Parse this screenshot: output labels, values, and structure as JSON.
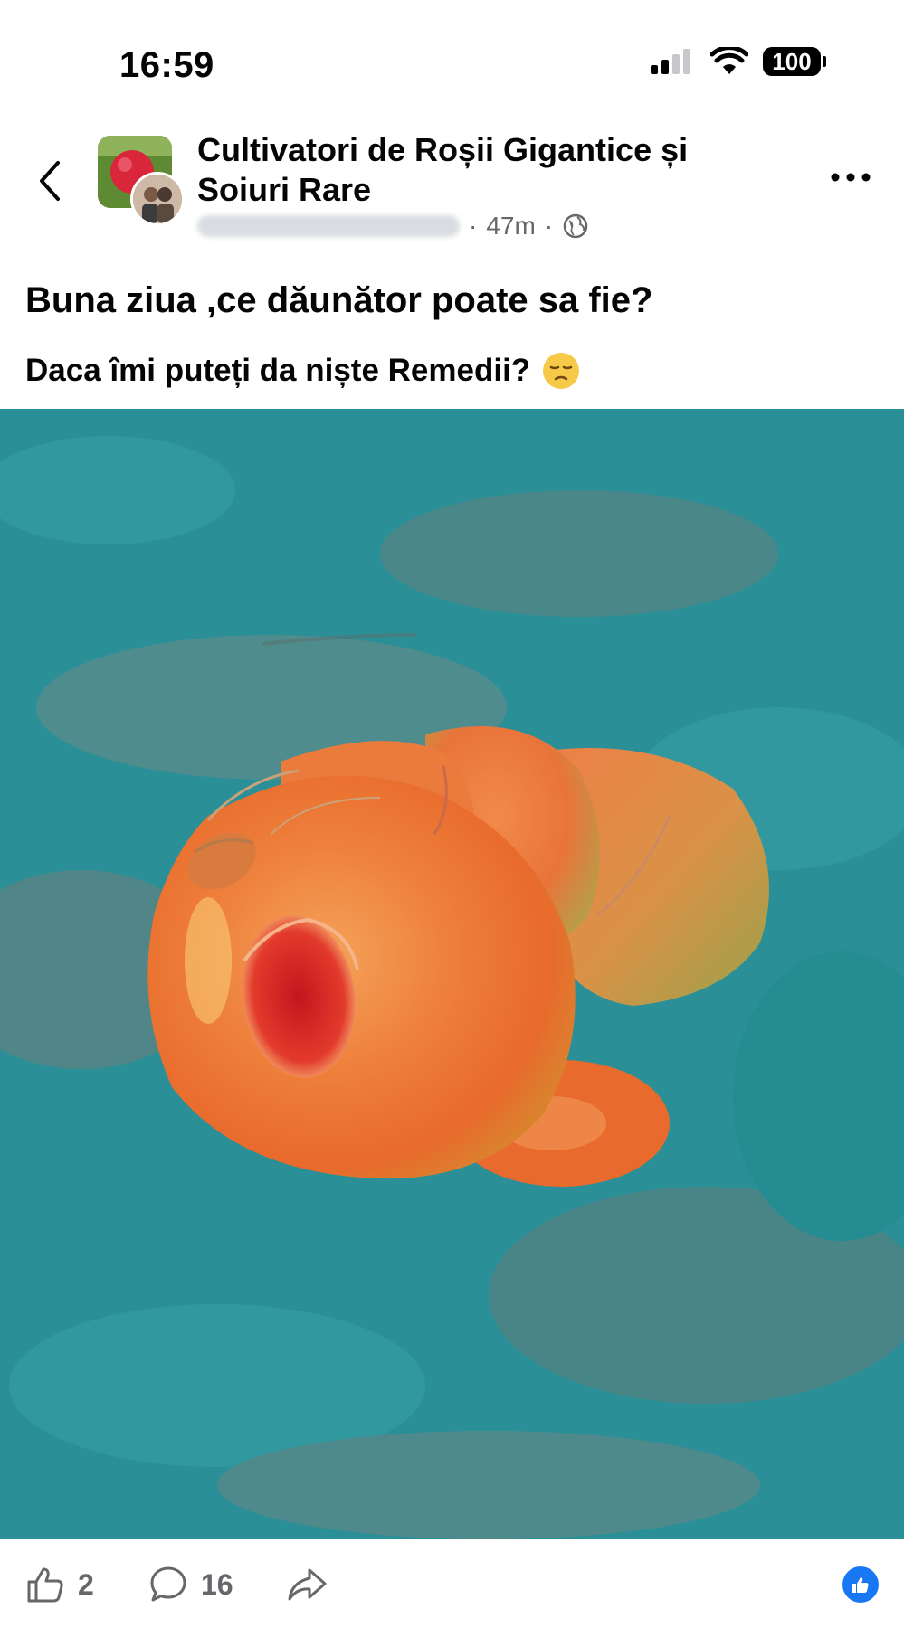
{
  "status_bar": {
    "time": "16:59",
    "battery": "100"
  },
  "header": {
    "group_name": "Cultivatori de Roșii Gigantice și Soiuri Rare",
    "time_ago": "47m",
    "separator": "·"
  },
  "post": {
    "title": "Buna ziua ,ce dăunător poate sa fie?",
    "body": "Daca îmi puteți da niște Remedii?"
  },
  "actions": {
    "likes": "2",
    "comments": "16"
  },
  "colors": {
    "accent": "#1877f2",
    "muted": "#65676b",
    "photo_background": "#2a8f96",
    "tomato": "#e8712e"
  },
  "icons": [
    "back-chevron-icon",
    "more-icon",
    "globe-icon",
    "like-icon",
    "comment-icon",
    "share-icon",
    "like-reaction-icon",
    "sad-face-emoji"
  ]
}
